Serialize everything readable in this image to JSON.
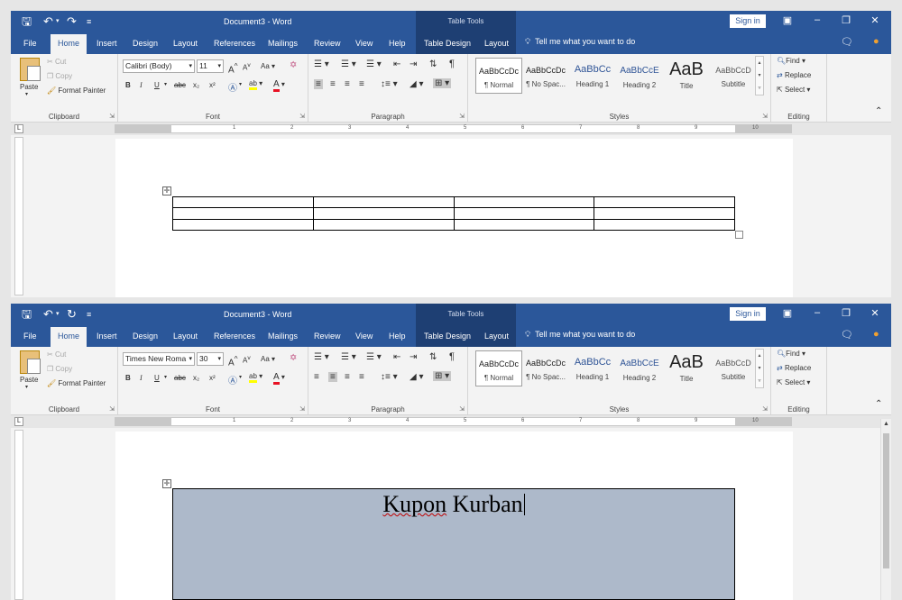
{
  "window": {
    "title": "Document3  -  Word",
    "contextual_header": "Table Tools",
    "sign_in": "Sign in"
  },
  "tabs": [
    "File",
    "Home",
    "Insert",
    "Design",
    "Layout",
    "References",
    "Mailings",
    "Review",
    "View",
    "Help",
    "Table Design",
    "Layout"
  ],
  "active_tab": "Home",
  "tell_me": "Tell me what you want to do",
  "clipboard": {
    "paste": "Paste",
    "cut": "Cut",
    "copy": "Copy",
    "format_painter": "Format Painter",
    "label": "Clipboard"
  },
  "font_group": {
    "label": "Font",
    "bold": "B",
    "italic": "I",
    "underline": "U",
    "strike": "abc",
    "subscript": "x₂",
    "superscript": "x²",
    "grow": "A",
    "shrink": "A",
    "case": "Aa"
  },
  "paragraph_group": {
    "label": "Paragraph"
  },
  "styles_group": {
    "label": "Styles",
    "items": [
      {
        "preview": "AaBbCcDc",
        "name": "¶ Normal"
      },
      {
        "preview": "AaBbCcDc",
        "name": "¶ No Spac..."
      },
      {
        "preview": "AaBbCc",
        "name": "Heading 1"
      },
      {
        "preview": "AaBbCcE",
        "name": "Heading 2"
      },
      {
        "preview": "AaB",
        "name": "Title"
      },
      {
        "preview": "AaBbCcD",
        "name": "Subtitle"
      }
    ]
  },
  "editing_group": {
    "label": "Editing",
    "find": "Find",
    "replace": "Replace",
    "select": "Select"
  },
  "ruler_numbers": [
    "1",
    "2",
    "3",
    "4",
    "5",
    "6",
    "7",
    "8",
    "9",
    "10"
  ],
  "top_window": {
    "font_name": "Calibri (Body)",
    "font_size": "11"
  },
  "bottom_window": {
    "font_name": "Times New Roma",
    "font_size": "30",
    "cell_text_word1": "Kupon",
    "cell_text_word2": "Kurban",
    "shading_color": "#adb9ca"
  },
  "colors": {
    "brand_blue": "#2b579a",
    "contextual_blue": "#1e3f73",
    "font_color_red": "#e81123",
    "highlight_yellow": "#ffff00"
  }
}
